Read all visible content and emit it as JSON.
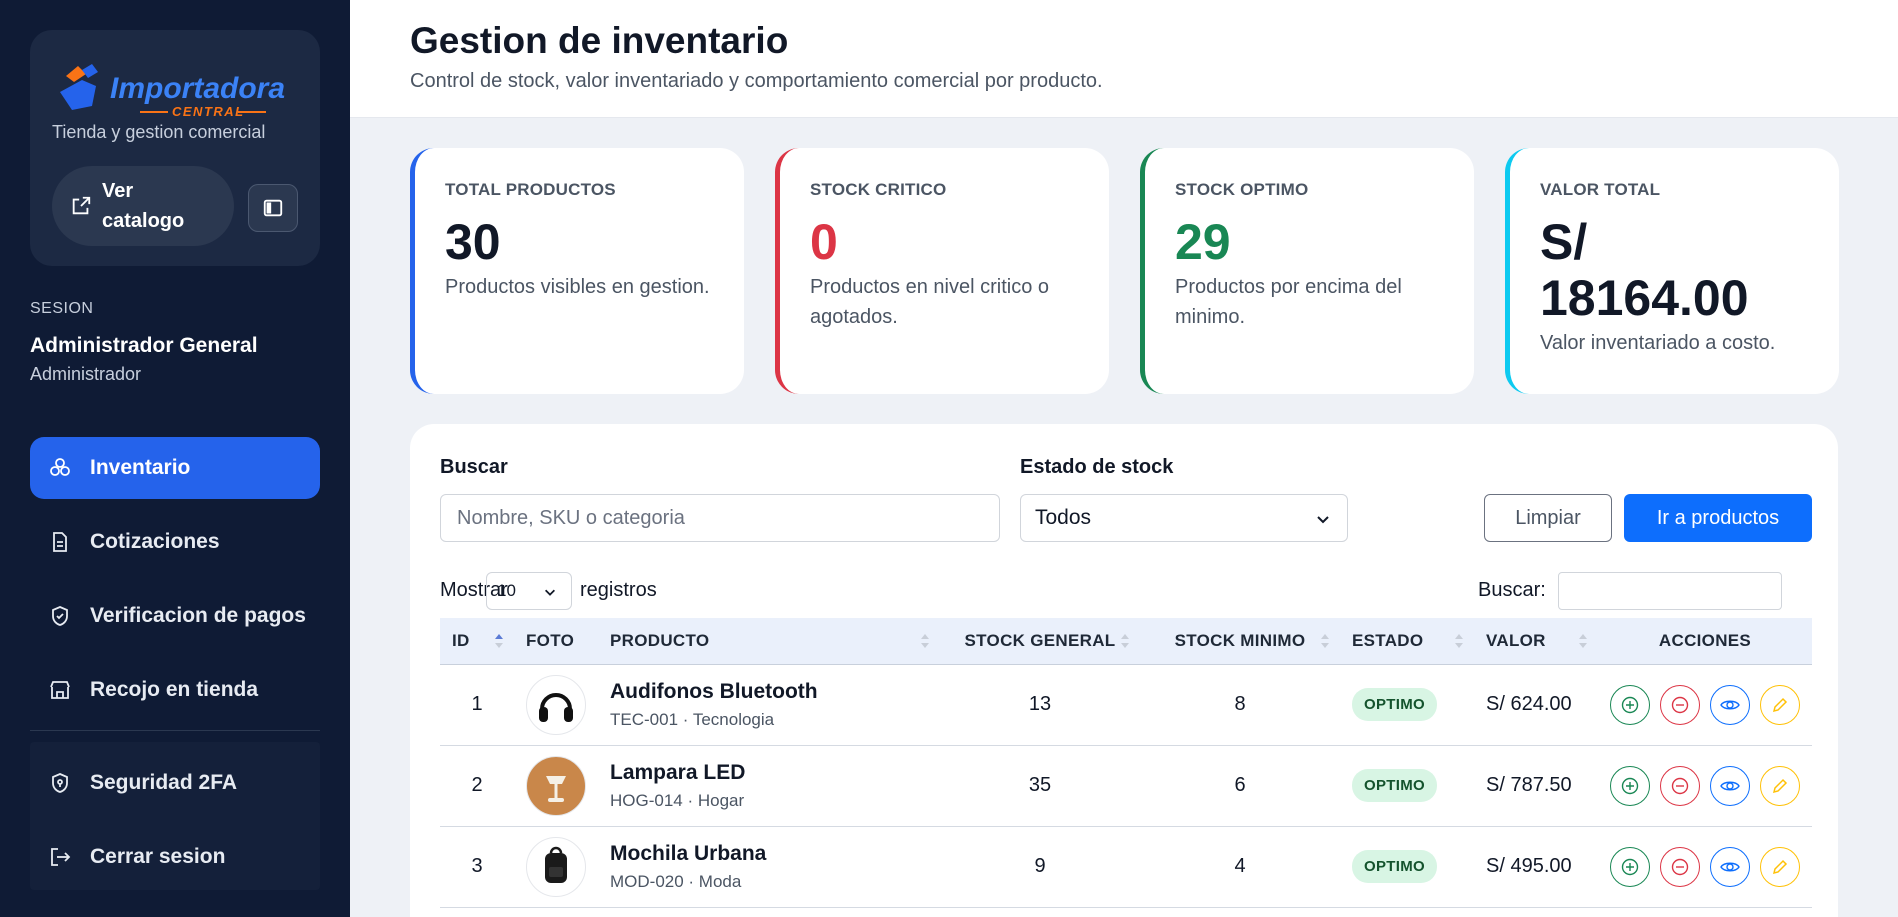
{
  "brand": {
    "logo_text": "Importadora",
    "logo_sub": "CENTRAL",
    "tagline": "Tienda y gestion comercial",
    "catalog_button": "Ver catalogo"
  },
  "session": {
    "label": "SESION",
    "name": "Administrador General",
    "role": "Administrador"
  },
  "nav": {
    "inventory": "Inventario",
    "quotes": "Cotizaciones",
    "payments": "Verificacion de pagos",
    "pickup": "Recojo en tienda",
    "security": "Seguridad 2FA",
    "logout": "Cerrar sesion"
  },
  "header": {
    "title": "Gestion de inventario",
    "subtitle": "Control de stock, valor inventariado y comportamiento comercial por producto."
  },
  "stats": [
    {
      "label": "TOTAL PRODUCTOS",
      "value": "30",
      "desc": "Productos visibles en gestion.",
      "color": "#2563eb",
      "value_color": "#111827"
    },
    {
      "label": "STOCK CRITICO",
      "value": "0",
      "desc": "Productos en nivel critico o agotados.",
      "color": "#dc3545",
      "value_color": "#dc3545"
    },
    {
      "label": "STOCK OPTIMO",
      "value": "29",
      "desc": "Productos por encima del minimo.",
      "color": "#198754",
      "value_color": "#198754"
    },
    {
      "label": "VALOR TOTAL",
      "value": "S/ 18164.00",
      "desc": "Valor inventariado a costo.",
      "color": "#0dcaf0",
      "value_color": "#111827"
    }
  ],
  "filters": {
    "search_label": "Buscar",
    "search_placeholder": "Nombre, SKU o categoria",
    "stock_label": "Estado de stock",
    "stock_value": "Todos",
    "clear_button": "Limpiar",
    "products_button": "Ir a productos"
  },
  "table_controls": {
    "show": "Mostrar",
    "page_length": "10",
    "records": "registros",
    "search": "Buscar:"
  },
  "table": {
    "columns": [
      "ID",
      "FOTO",
      "PRODUCTO",
      "STOCK GENERAL",
      "STOCK MINIMO",
      "ESTADO",
      "VALOR",
      "ACCIONES"
    ],
    "rows": [
      {
        "id": "1",
        "name": "Audifonos Bluetooth",
        "sku": "TEC-001 · Tecnologia",
        "stock": "13",
        "min": "8",
        "status": "OPTIMO",
        "value": "S/ 624.00",
        "thumb": "headphones"
      },
      {
        "id": "2",
        "name": "Lampara LED",
        "sku": "HOG-014 · Hogar",
        "stock": "35",
        "min": "6",
        "status": "OPTIMO",
        "value": "S/ 787.50",
        "thumb": "lamp"
      },
      {
        "id": "3",
        "name": "Mochila Urbana",
        "sku": "MOD-020 · Moda",
        "stock": "9",
        "min": "4",
        "status": "OPTIMO",
        "value": "S/ 495.00",
        "thumb": "backpack"
      }
    ]
  }
}
